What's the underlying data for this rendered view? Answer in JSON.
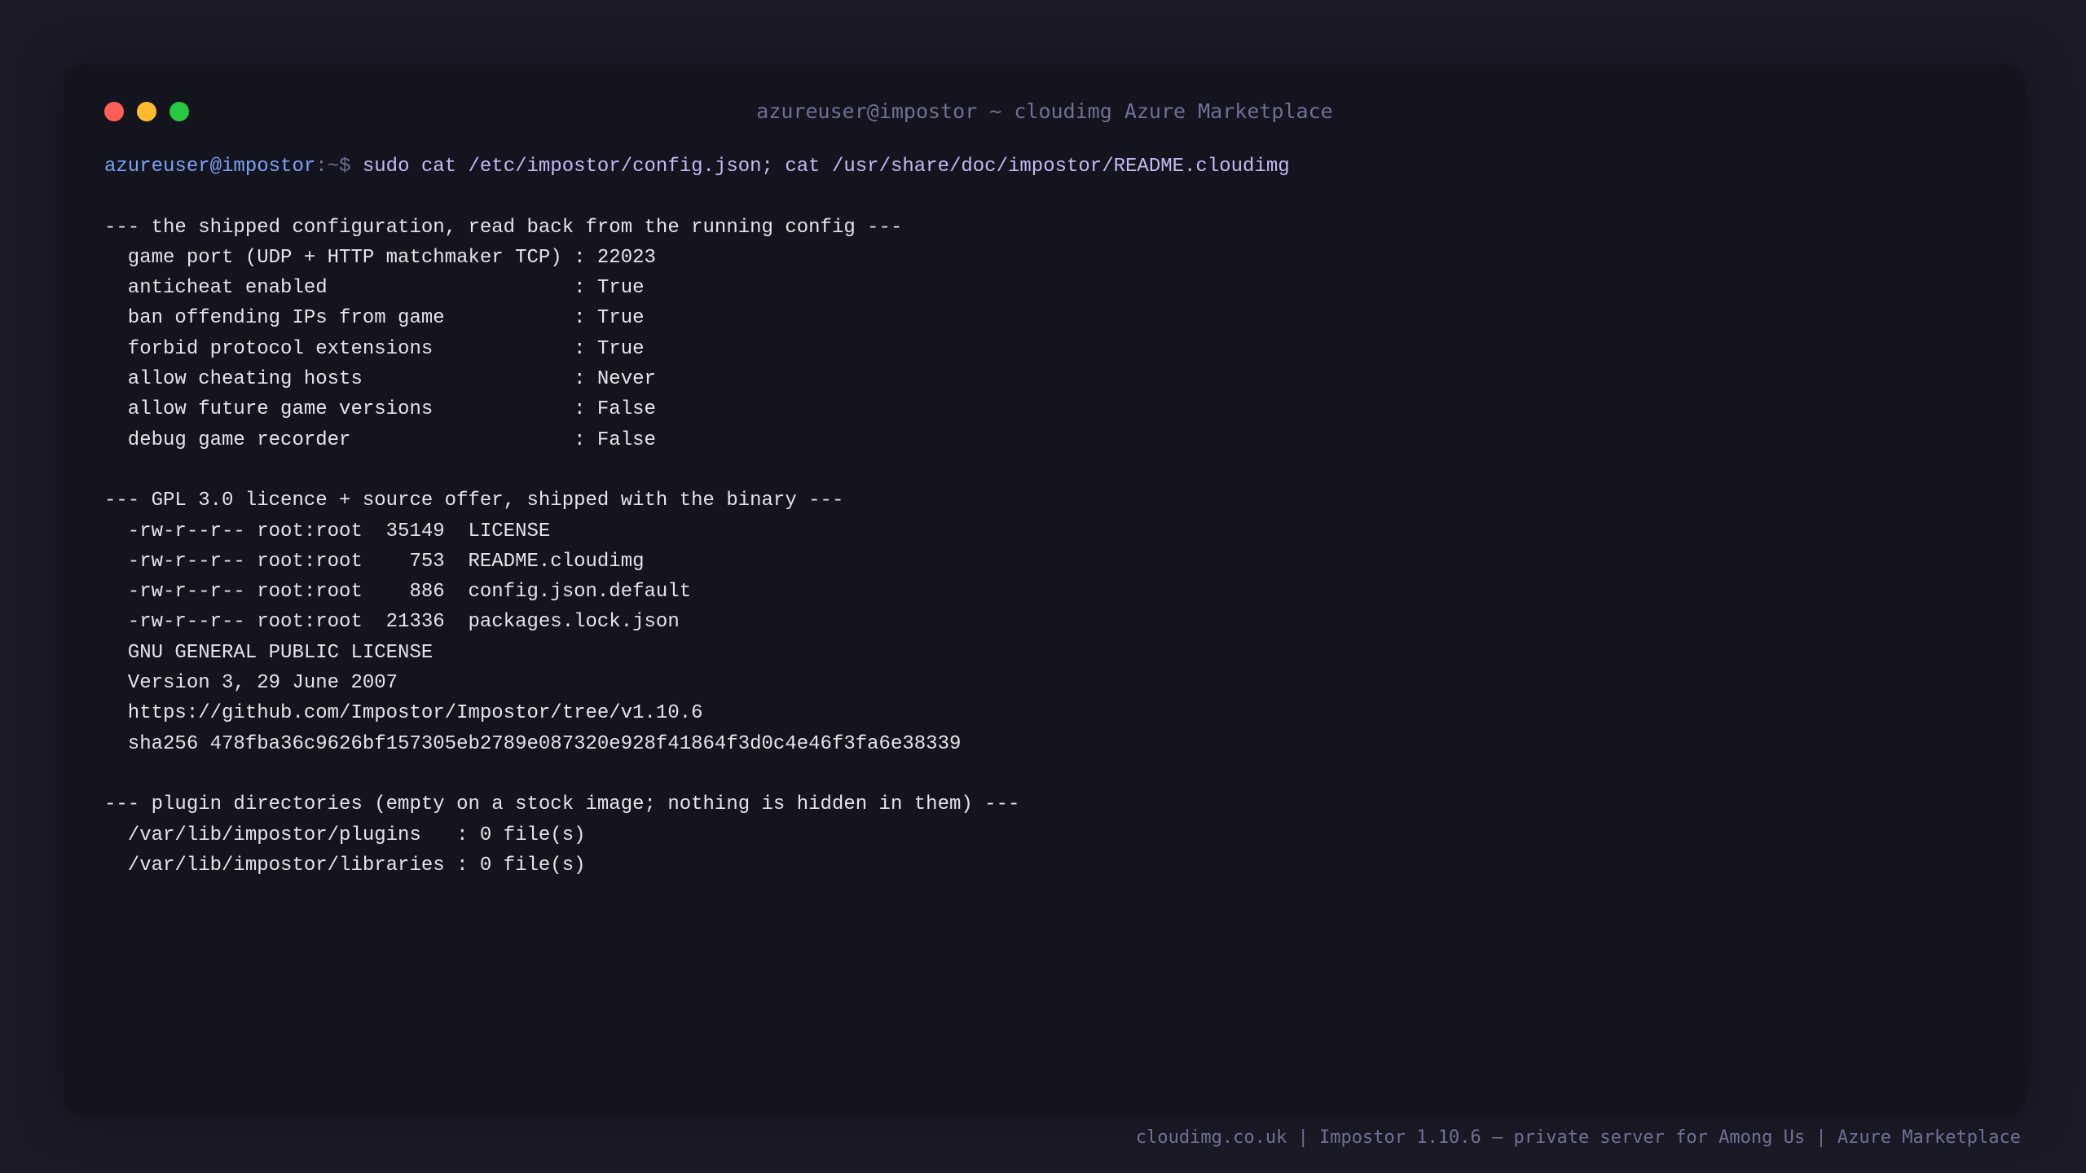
{
  "window": {
    "title": "azureuser@impostor ~ cloudimg Azure Marketplace"
  },
  "prompt": {
    "user_host": "azureuser@impostor",
    "path": ":~$ ",
    "command": "sudo cat /etc/impostor/config.json; cat /usr/share/doc/impostor/README.cloudimg"
  },
  "output": {
    "config_header": "--- the shipped configuration, read back from the running config ---",
    "config_lines": [
      "  game port (UDP + HTTP matchmaker TCP) : 22023",
      "  anticheat enabled                     : True",
      "  ban offending IPs from game           : True",
      "  forbid protocol extensions            : True",
      "  allow cheating hosts                  : Never",
      "  allow future game versions            : False",
      "  debug game recorder                   : False"
    ],
    "licence_header": "--- GPL 3.0 licence + source offer, shipped with the binary ---",
    "licence_lines": [
      "  -rw-r--r-- root:root  35149  LICENSE",
      "  -rw-r--r-- root:root    753  README.cloudimg",
      "  -rw-r--r-- root:root    886  config.json.default",
      "  -rw-r--r-- root:root  21336  packages.lock.json",
      "  GNU GENERAL PUBLIC LICENSE",
      "  Version 3, 29 June 2007",
      "  https://github.com/Impostor/Impostor/tree/v1.10.6",
      "  sha256 478fba36c9626bf157305eb2789e087320e928f41864f3d0c4e46f3fa6e38339"
    ],
    "plugins_header": "--- plugin directories (empty on a stock image; nothing is hidden in them) ---",
    "plugins_lines": [
      "  /var/lib/impostor/plugins   : 0 file(s)",
      "  /var/lib/impostor/libraries : 0 file(s)"
    ]
  },
  "footer": {
    "text": "cloudimg.co.uk | Impostor 1.10.6 — private server for Among Us | Azure Marketplace"
  },
  "colors": {
    "background": "#1b1b28",
    "window": "#14141e",
    "prompt_user": "#7aa2f7",
    "command": "#c7b8f5",
    "dot_red": "#ff5f57",
    "dot_yellow": "#febc2e",
    "dot_green": "#28c840"
  }
}
